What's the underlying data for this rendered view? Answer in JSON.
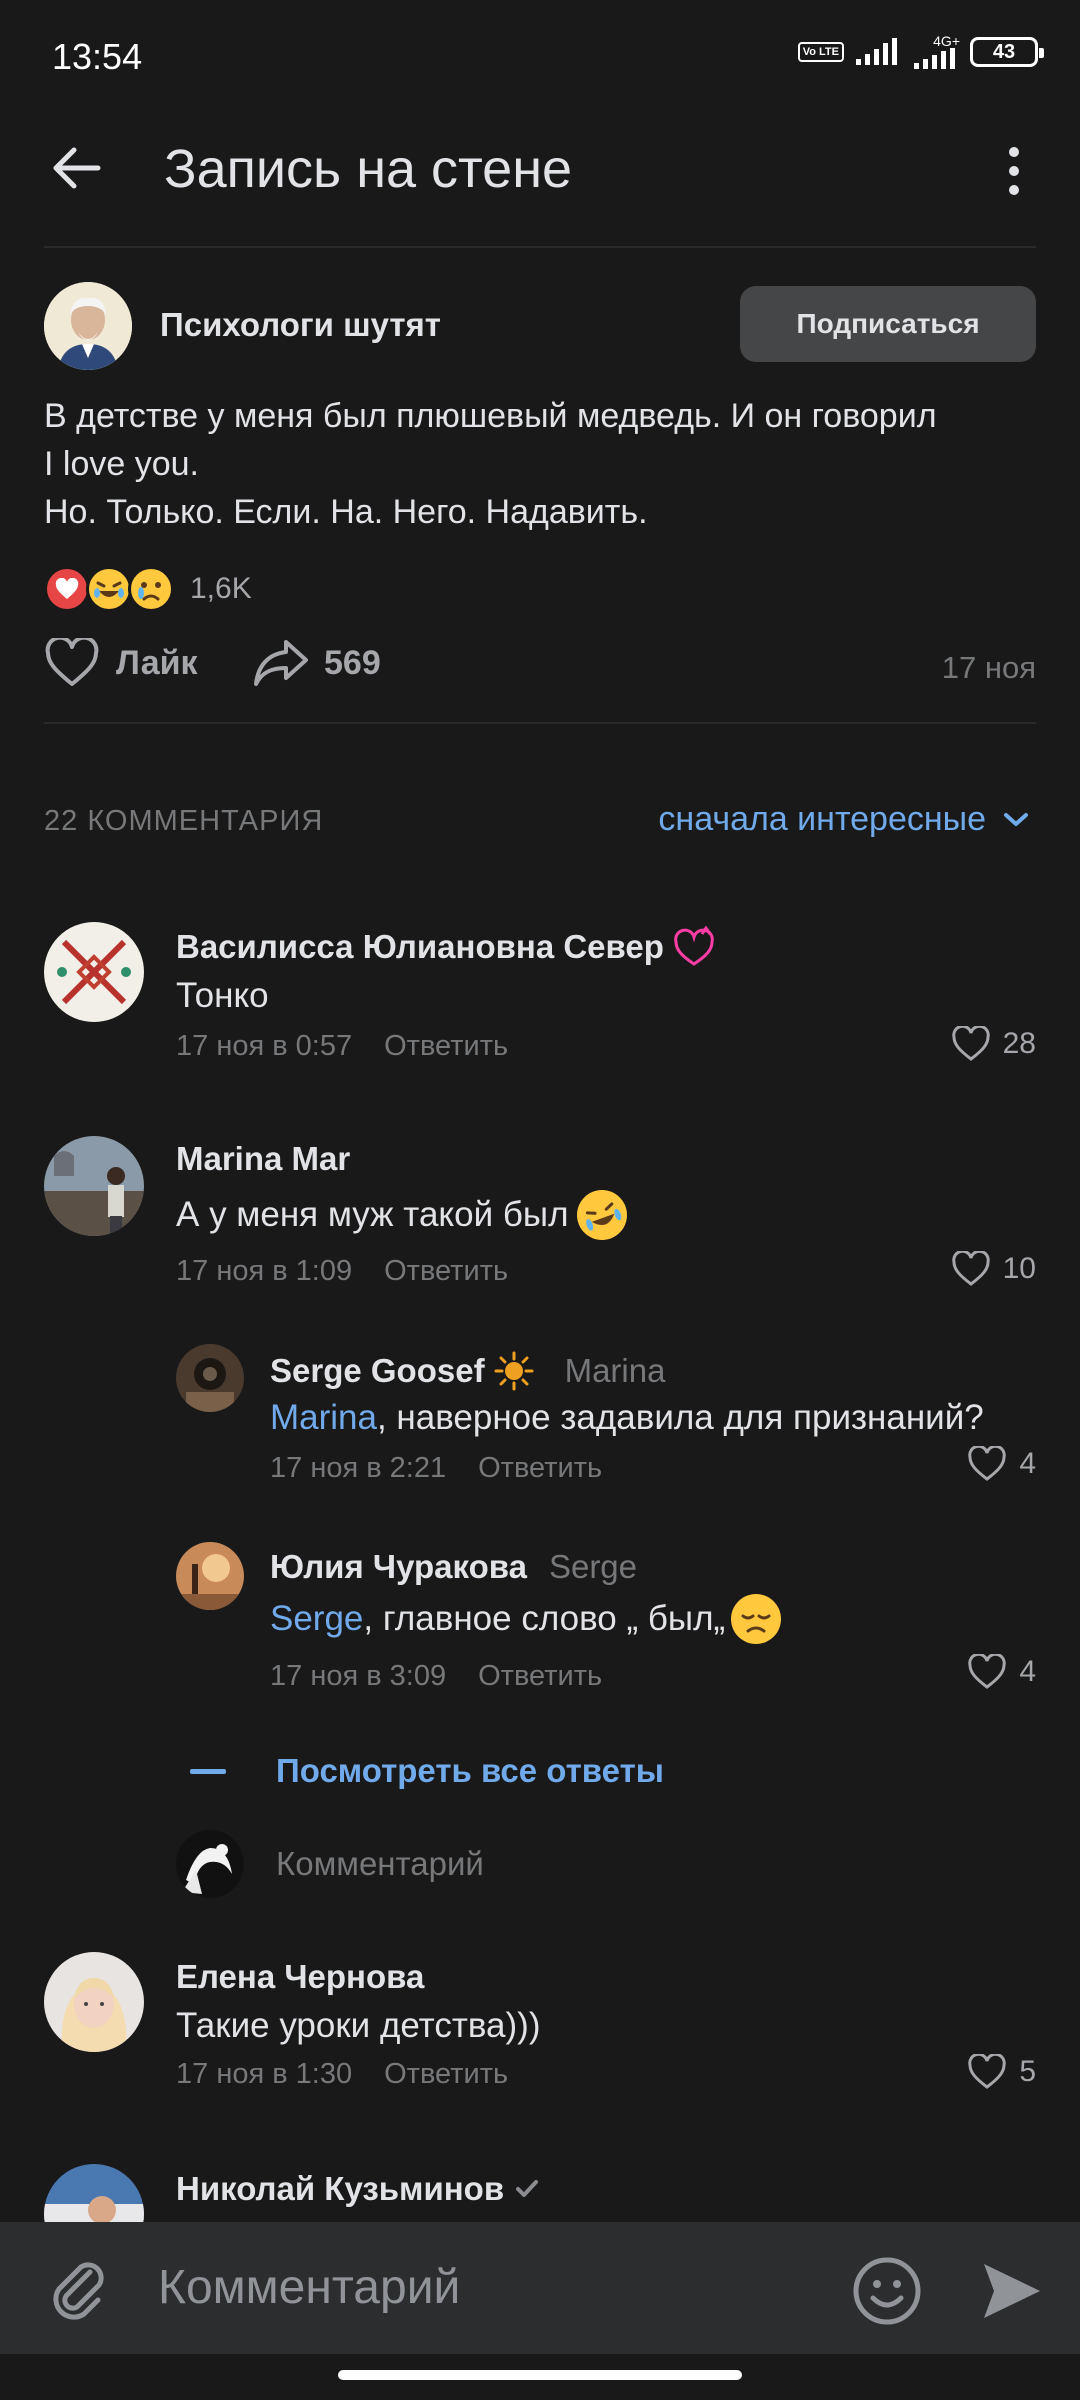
{
  "status_bar": {
    "time": "13:54",
    "volte": "Vo LTE",
    "network": "4G+",
    "battery": "43"
  },
  "header": {
    "title": "Запись на стене"
  },
  "post": {
    "group_name": "Психологи шутят",
    "subscribe_label": "Подписаться",
    "text_lines": [
      "В детстве у меня был плюшевый медведь. И он говорил",
      "I love you.",
      "Но. Только. Если. На. Него. Надавить."
    ],
    "reactions_count": "1,6K",
    "like_label": "Лайк",
    "shares": "569",
    "date": "17 ноя"
  },
  "comments_header": {
    "count_label": "22 КОММЕНТАРИЯ",
    "sort_label": "сначала интересные"
  },
  "comments": [
    {
      "name": "Василисса Юлиановна Север",
      "text": "Тонко",
      "date": "17 ноя в 0:57",
      "reply_label": "Ответить",
      "likes": "28"
    },
    {
      "name": "Marina Mar",
      "text": "А у меня муж такой был",
      "date": "17 ноя в 1:09",
      "reply_label": "Ответить",
      "likes": "10"
    },
    {
      "name": "Елена Чернова",
      "text": "Такие уроки детства)))",
      "date": "17 ноя в 1:30",
      "reply_label": "Ответить",
      "likes": "5"
    },
    {
      "name": "Николай Кузьминов"
    }
  ],
  "replies": [
    {
      "name": "Serge Goosef",
      "reply_to": "Marina",
      "mention": "Marina",
      "text": ", наверное задавила для признаний?",
      "date": "17 ноя в 2:21",
      "reply_label": "Ответить",
      "likes": "4"
    },
    {
      "name": "Юлия Чуракова",
      "reply_to": "Serge",
      "mention": "Serge",
      "text": ", главное слово „ был„",
      "date": "17 ноя в 3:09",
      "reply_label": "Ответить",
      "likes": "4"
    }
  ],
  "show_all_replies": "Посмотреть все ответы",
  "reply_input_placeholder": "Комментарий",
  "bottom_input_placeholder": "Комментарий",
  "colors": {
    "background": "#19191a",
    "accent": "#71aaeb",
    "like_red": "#e64646",
    "secondary_text": "#76787a"
  }
}
